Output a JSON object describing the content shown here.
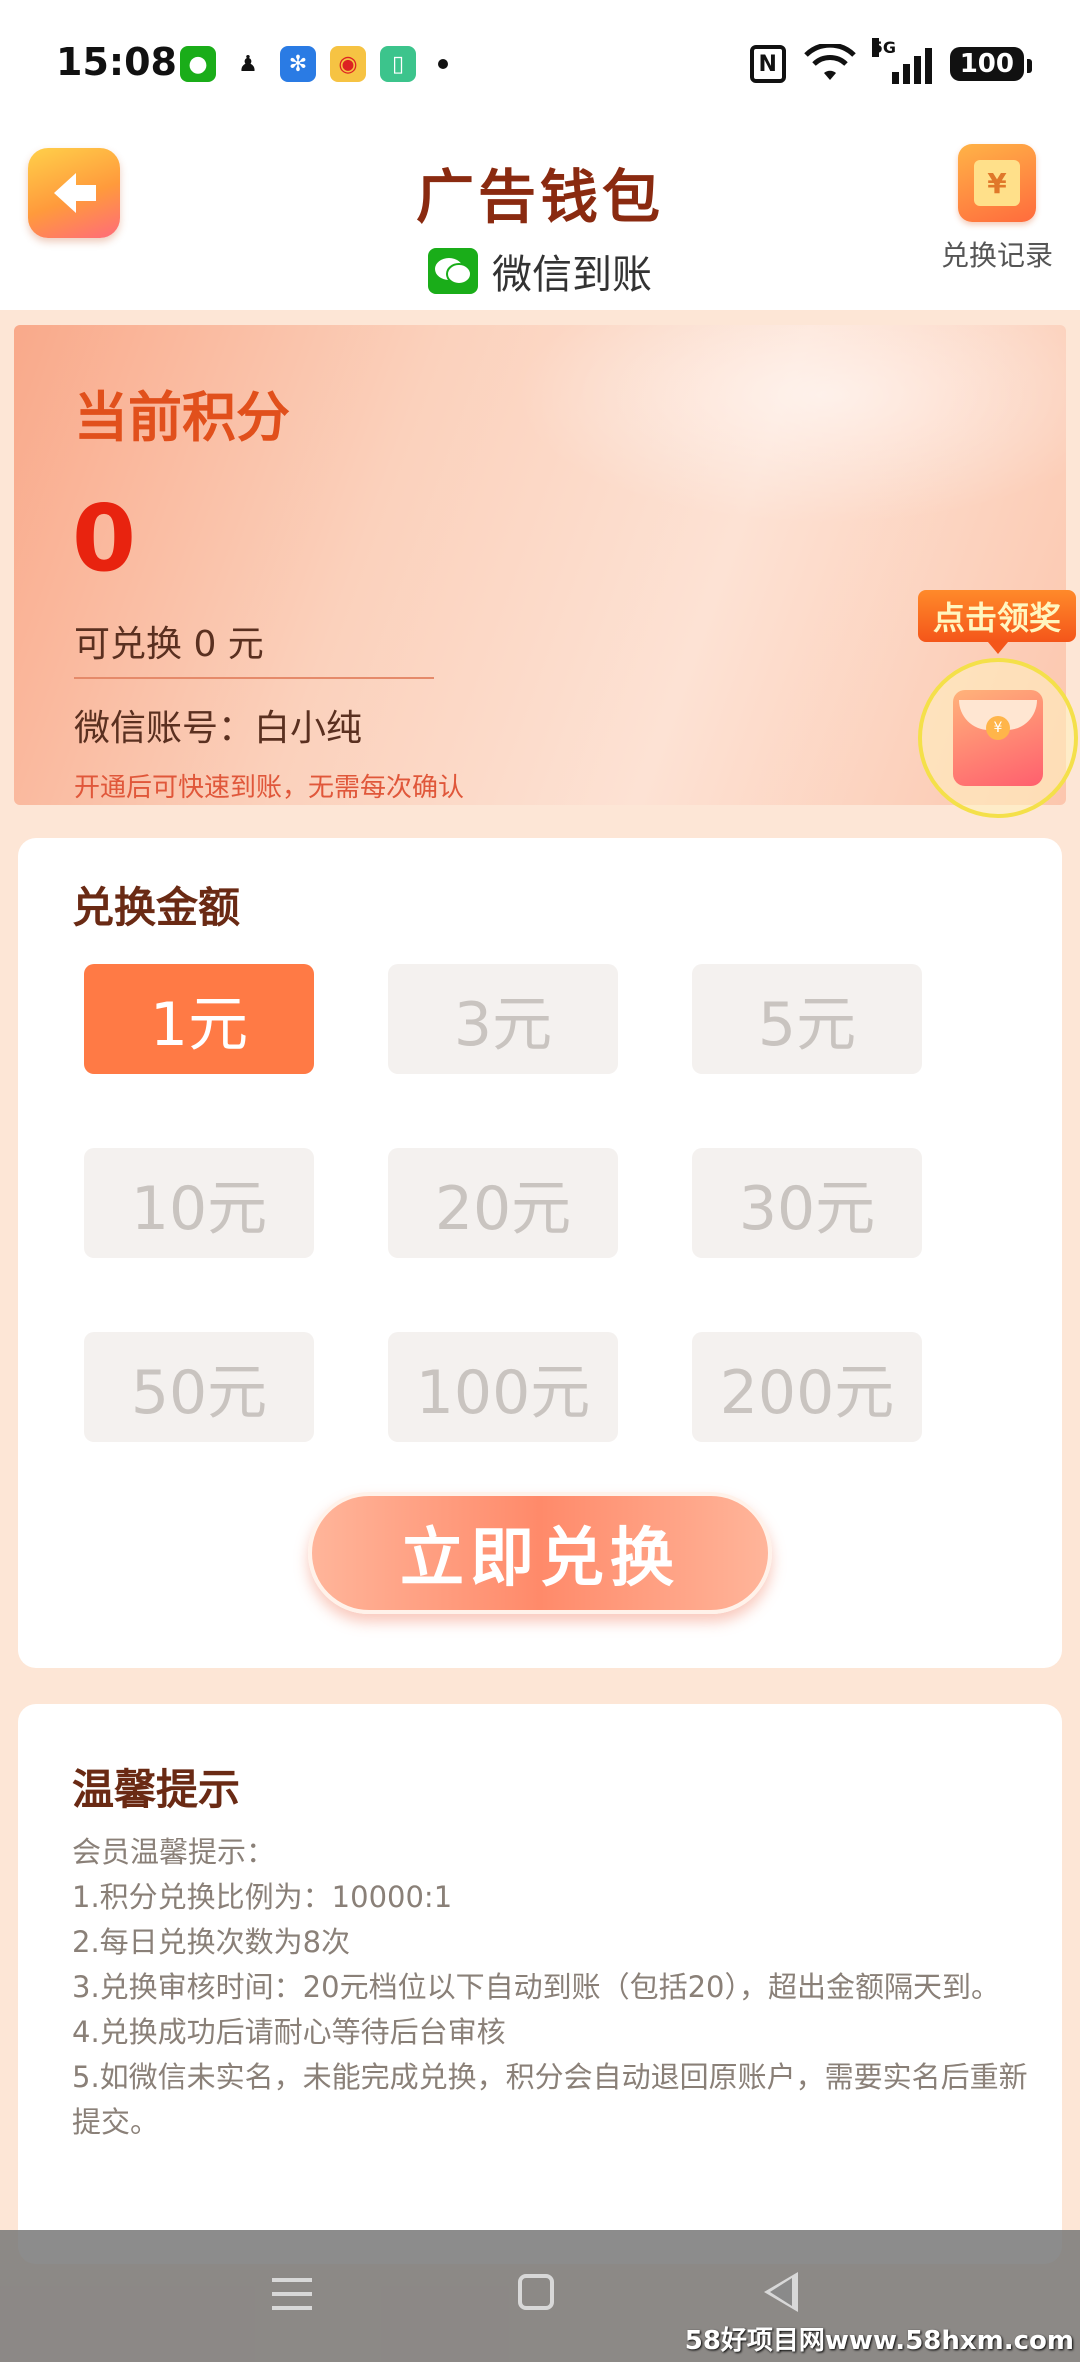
{
  "status_bar": {
    "time": "15:08",
    "network": "5G",
    "battery": "100"
  },
  "header": {
    "title": "广告钱包",
    "subtitle": "微信到账",
    "record_label": "兑换记录",
    "record_icon_glyph": "¥"
  },
  "points": {
    "label": "当前积分",
    "value": "0",
    "exchangeable": "可兑换 0 元",
    "account": "微信账号：白小纯",
    "note": "开通后可快速到账，无需每次确认"
  },
  "reward": {
    "label": "点击领奖"
  },
  "exchange": {
    "title": "兑换金额",
    "amounts": [
      "1元",
      "3元",
      "5元",
      "10元",
      "20元",
      "30元",
      "50元",
      "100元",
      "200元"
    ],
    "selected_index": 0,
    "button_label": "立即兑换"
  },
  "tips": {
    "title": "温馨提示",
    "lines": [
      "会员温馨提示：",
      "1.积分兑换比例为：10000:1",
      "2.每日兑换次数为8次",
      "3.兑换审核时间：20元档位以下自动到账（包括20），超出金额隔天到。",
      "4.兑换成功后请耐心等待后台审核",
      "5.如微信未实名，未能完成兑换，积分会自动退回原账户，需要实名后重新提交。"
    ]
  },
  "watermark": "58好项目网www.58hxm.com",
  "colors": {
    "accent": "#ff7a45",
    "title": "#8a2a10",
    "points_red": "#e8230f",
    "wechat_green": "#1aad19"
  }
}
